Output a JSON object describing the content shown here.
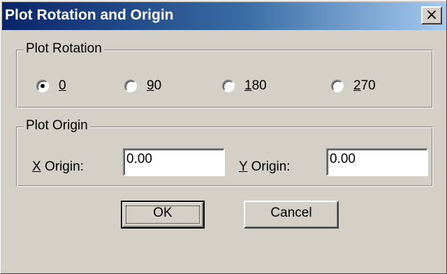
{
  "dialog": {
    "title": "Plot Rotation and Origin",
    "close_glyph": "×",
    "colors": {
      "face": "#d4d0c8",
      "title_start": "#0a246a",
      "title_end": "#a6caf0",
      "title_text": "#ffffff"
    }
  },
  "rotation": {
    "legend": "Plot Rotation",
    "selected": "0",
    "options": [
      {
        "mnemonic": "0",
        "rest": "",
        "selected": true
      },
      {
        "mnemonic": "9",
        "rest": "0",
        "selected": false
      },
      {
        "mnemonic": "1",
        "rest": "80",
        "selected": false
      },
      {
        "mnemonic": "2",
        "rest": "70",
        "selected": false
      }
    ]
  },
  "origin": {
    "legend": "Plot Origin",
    "x_label_mnemonic": "X",
    "x_label_rest": " Origin:",
    "x_value": "0.00",
    "y_label_mnemonic": "Y",
    "y_label_rest": " Origin:",
    "y_value": "0.00"
  },
  "buttons": {
    "ok_label": "OK",
    "cancel_label": "Cancel"
  }
}
